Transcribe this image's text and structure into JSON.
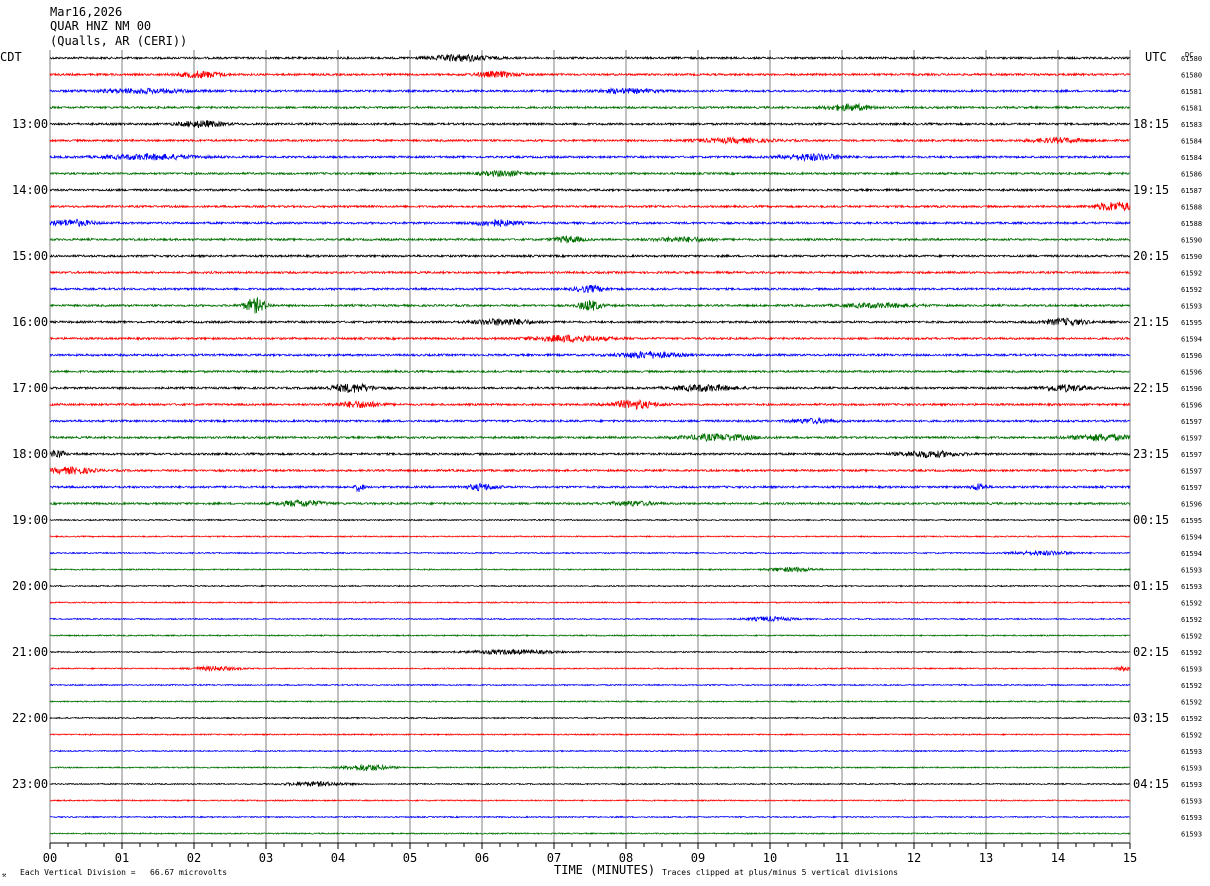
{
  "header": {
    "date": "Mar16,2026",
    "station": "QUAR HNZ NM 00",
    "location": "(Qualls, AR (CERI))"
  },
  "left_axis_label": "CDT",
  "right_axis_label": "UTC",
  "dc_label": "DC",
  "footer": {
    "scale": "Each Vertical Division =   66.67 microvolts",
    "xlabel": "TIME (MINUTES)",
    "clip_note": "Traces clipped at plus/minus 5 vertical divisions"
  },
  "colors": {
    "trace_cycle": [
      "#000000",
      "#ff0000",
      "#0000ff",
      "#007000"
    ],
    "grid": "#808080",
    "text": "#000000"
  },
  "chart_data": {
    "type": "line",
    "subtype": "helicorder",
    "xlim": [
      0,
      15
    ],
    "xticks": [
      "00",
      "01",
      "02",
      "03",
      "04",
      "05",
      "06",
      "07",
      "08",
      "09",
      "10",
      "11",
      "12",
      "13",
      "14",
      "15"
    ],
    "minutes_per_line": 15,
    "left_hour_labels": [
      "13:00",
      "14:00",
      "15:00",
      "16:00",
      "17:00",
      "18:00",
      "19:00",
      "20:00",
      "21:00",
      "22:00",
      "23:00"
    ],
    "right_hour_labels": [
      "18:15",
      "19:15",
      "20:15",
      "21:15",
      "22:15",
      "23:15",
      "00:15",
      "01:15",
      "02:15",
      "03:15",
      "04:15"
    ],
    "hour_label_first_trace": 4,
    "traces_per_hour": 4,
    "dc_values": [
      "61580",
      "61580",
      "61581",
      "61581",
      "61583",
      "61584",
      "61584",
      "61586",
      "61587",
      "61588",
      "61588",
      "61590",
      "61590",
      "61592",
      "61592",
      "61593",
      "61595",
      "61594",
      "61596",
      "61596",
      "61596",
      "61596",
      "61597",
      "61597",
      "61597",
      "61597",
      "61597",
      "61596",
      "61595",
      "61594",
      "61594",
      "61593",
      "61593",
      "61592",
      "61592",
      "61592",
      "61592",
      "61593",
      "61592",
      "61592",
      "61592",
      "61592",
      "61593",
      "61593",
      "61593",
      "61593",
      "61593",
      "61593"
    ],
    "activity": [
      [
        [
          5.7,
          0.4,
          3
        ]
      ],
      [
        [
          2.1,
          0.3,
          3
        ],
        [
          6.2,
          0.3,
          2.5
        ]
      ],
      [
        [
          1.3,
          0.6,
          2
        ],
        [
          8.0,
          0.4,
          2
        ]
      ],
      [
        [
          11.1,
          0.3,
          3
        ]
      ],
      [
        [
          2.1,
          0.3,
          3
        ]
      ],
      [
        [
          9.5,
          0.5,
          2
        ],
        [
          14.0,
          0.4,
          2
        ]
      ],
      [
        [
          1.4,
          0.6,
          2.5
        ],
        [
          10.6,
          0.4,
          3
        ]
      ],
      [
        [
          6.3,
          0.3,
          2.5
        ]
      ],
      [],
      [
        [
          14.8,
          0.3,
          4
        ]
      ],
      [
        [
          0.3,
          0.3,
          3
        ],
        [
          6.2,
          0.3,
          3
        ]
      ],
      [
        [
          7.2,
          0.2,
          3
        ],
        [
          8.8,
          0.4,
          2
        ]
      ],
      [],
      [],
      [
        [
          7.5,
          0.2,
          3
        ]
      ],
      [
        [
          2.85,
          0.15,
          7
        ],
        [
          7.5,
          0.15,
          5
        ],
        [
          11.5,
          0.5,
          2
        ]
      ],
      [
        [
          6.3,
          0.4,
          3
        ],
        [
          14.1,
          0.3,
          3
        ]
      ],
      [
        [
          7.2,
          0.5,
          3
        ]
      ],
      [
        [
          8.3,
          0.4,
          3
        ]
      ],
      [],
      [
        [
          4.2,
          0.3,
          4
        ],
        [
          9.1,
          0.4,
          3
        ],
        [
          14.1,
          0.3,
          3
        ]
      ],
      [
        [
          4.3,
          0.3,
          3
        ],
        [
          8.1,
          0.3,
          4
        ]
      ],
      [
        [
          10.6,
          0.3,
          2
        ]
      ],
      [
        [
          9.3,
          0.5,
          3
        ],
        [
          14.6,
          0.4,
          3
        ]
      ],
      [
        [
          0.1,
          0.1,
          4
        ],
        [
          12.2,
          0.4,
          3
        ]
      ],
      [
        [
          0.3,
          0.3,
          3
        ]
      ],
      [
        [
          4.3,
          0.05,
          5
        ],
        [
          6.0,
          0.2,
          3
        ],
        [
          12.9,
          0.1,
          3
        ]
      ],
      [
        [
          3.5,
          0.3,
          3
        ],
        [
          8.1,
          0.3,
          2
        ]
      ],
      [],
      [],
      [
        [
          13.8,
          0.4,
          2
        ]
      ],
      [
        [
          10.3,
          0.3,
          2
        ]
      ],
      [],
      [],
      [
        [
          10.0,
          0.3,
          2
        ]
      ],
      [],
      [
        [
          6.4,
          0.6,
          2
        ]
      ],
      [
        [
          2.3,
          0.3,
          2
        ],
        [
          14.9,
          0.1,
          2
        ]
      ],
      [],
      [],
      [],
      [],
      [],
      [
        [
          4.4,
          0.3,
          3
        ]
      ],
      [
        [
          3.7,
          0.4,
          2
        ]
      ],
      [],
      [],
      []
    ]
  }
}
